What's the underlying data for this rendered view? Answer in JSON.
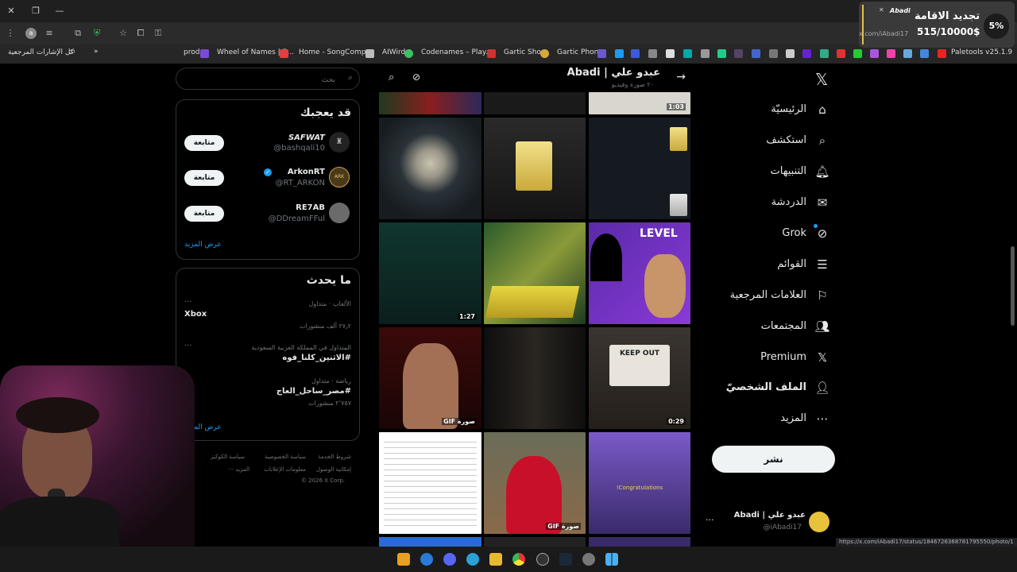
{
  "browser": {
    "bookmarks_folder": "كل الإشارات المرجعية",
    "bookmarks": [
      "prod",
      "Wheel of Names | R...",
      "Home - SongComp...",
      "AIWird",
      "Codenames – Play...",
      "Gartic Show",
      "Gartic Phone",
      "Paletools v25.1.9"
    ],
    "status_url": "https://x.com/iAbadi17/status/1846726368781795550/photo/1",
    "avatar_letter": "a"
  },
  "overlay": {
    "percent": "5%",
    "title": "تجديد الاقامة",
    "amount": "515/10000$",
    "handle_tag": "Abadi",
    "handle_url": "x.com/iAbadi17"
  },
  "left": {
    "search_placeholder": "بحث",
    "who_to_follow": {
      "title": "قد يعجبك",
      "users": [
        {
          "name": "SAFWAT",
          "handle": "@bashqali10",
          "button": "متابعة"
        },
        {
          "name": "ArkonRT",
          "handle": "@RT_ARKON",
          "button": "متابعة"
        },
        {
          "name": "RE7AB",
          "handle": "@DDreamFFul",
          "button": "متابعة"
        }
      ],
      "show_more": "عرض المزيد"
    },
    "trends": {
      "title": "ما يحدث",
      "items": [
        {
          "meta": "الألعاب · متداول",
          "name": "Xbox",
          "count": "٢٧٫٢ ألف منشورات"
        },
        {
          "meta": "المتداول في المملكة العربية السعودية",
          "name": "#الاثنين_كلنا_فوه",
          "count": ""
        },
        {
          "meta": "رياضة · متداول",
          "name": "#مصر_ساحل_العاج",
          "count": "٢٬٧٥٧ منشورات"
        }
      ],
      "show_more": "عرض المزيد"
    },
    "footer": [
      "شروط الخدمة",
      "سياسة الخصوصية",
      "سياسة الكوكيز",
      "إمكانية الوصول",
      "معلومات الإعلانات",
      "··· المزيد",
      "© 2026 X Corp."
    ]
  },
  "center": {
    "header_name": "عبدو علي | Abadi",
    "header_sub": "٢٠ صورة وفيديو",
    "tiles": [
      {
        "label": "",
        "dur": ""
      },
      {
        "label": "",
        "dur": ""
      },
      {
        "label": "",
        "dur": "1:03"
      },
      {
        "label": "",
        "dur": ""
      },
      {
        "label": "",
        "dur": ""
      },
      {
        "label": "",
        "dur": ""
      },
      {
        "label": "",
        "dur": "1:27"
      },
      {
        "label": "",
        "dur": ""
      },
      {
        "label": "",
        "dur": ""
      },
      {
        "label": "GIF صورة",
        "dur": ""
      },
      {
        "label": "",
        "dur": ""
      },
      {
        "label": "",
        "dur": "0:29"
      },
      {
        "label": "",
        "dur": ""
      },
      {
        "label": "GIF صورة",
        "dur": ""
      },
      {
        "label": "",
        "dur": ""
      }
    ],
    "tile_texts": {
      "keep_out": "KEEP OUT",
      "level": "LEVEL",
      "congrats": "!Congratulations"
    }
  },
  "nav": {
    "items": [
      "الرئيسيّة",
      "استكشف",
      "التنبيهات",
      "الدردشة",
      "Grok",
      "القوائم",
      "العلامات المرجعية",
      "المجتمعات",
      "Premium",
      "الملف الشخصيّ",
      "المزيد"
    ],
    "post": "نشر",
    "profile_name": "عبدو علي | Abadi",
    "profile_handle": "@iAbadi17"
  },
  "colors": {
    "accent": "#1d9bf0",
    "bg": "#000000",
    "text": "#e7e9ea",
    "muted": "#71767b"
  }
}
